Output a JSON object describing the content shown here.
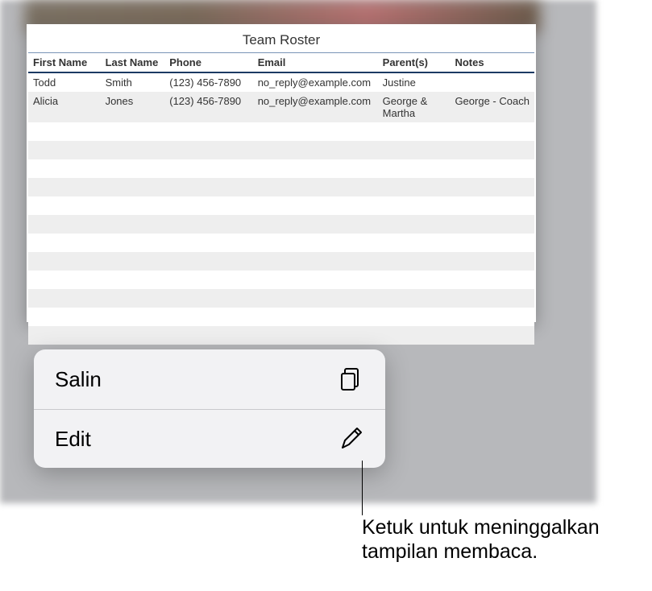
{
  "sheet": {
    "title": "Team Roster",
    "columns": [
      "First Name",
      "Last Name",
      "Phone",
      "Email",
      "Parent(s)",
      "Notes"
    ],
    "rows": [
      {
        "first": "Todd",
        "last": "Smith",
        "phone": "(123) 456-7890",
        "email": "no_reply@example.com",
        "parents": "Justine",
        "notes": ""
      },
      {
        "first": "Alicia",
        "last": "Jones",
        "phone": "(123) 456-7890",
        "email": "no_reply@example.com",
        "parents": "George & Martha",
        "notes": "George - Coach"
      }
    ],
    "emptyRowCount": 12
  },
  "menu": {
    "copy_label": "Salin",
    "edit_label": "Edit"
  },
  "callout": {
    "text": "Ketuk untuk meninggalkan tampilan membaca."
  }
}
